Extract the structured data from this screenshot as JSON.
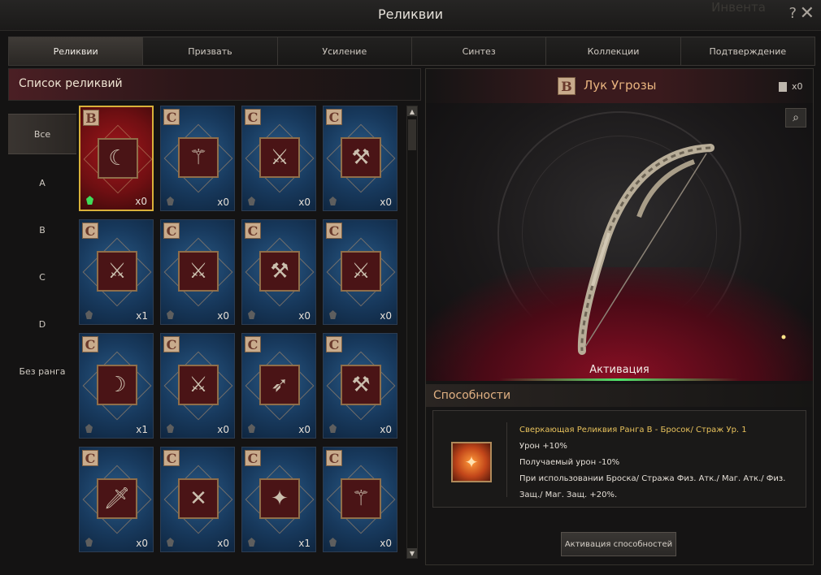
{
  "window": {
    "title": "Реликвии",
    "background_hint": "Инвента",
    "help_symbol": "?",
    "close_symbol": "✕"
  },
  "tabs": [
    {
      "label": "Реликвии",
      "active": true
    },
    {
      "label": "Призвать",
      "active": false
    },
    {
      "label": "Усиление",
      "active": false
    },
    {
      "label": "Синтез",
      "active": false
    },
    {
      "label": "Коллекции",
      "active": false
    },
    {
      "label": "Подтверждение",
      "active": false
    }
  ],
  "list": {
    "title": "Список реликвий",
    "filters": [
      {
        "label": "Все",
        "active": true
      },
      {
        "label": "A",
        "active": false
      },
      {
        "label": "B",
        "active": false
      },
      {
        "label": "C",
        "active": false
      },
      {
        "label": "D",
        "active": false
      },
      {
        "label": "Без ранга",
        "active": false
      }
    ],
    "cards": [
      {
        "rank": "B",
        "icon": "bow-icon",
        "glyph": "☾",
        "count": "x0",
        "gem": "on",
        "selected": true
      },
      {
        "rank": "C",
        "icon": "staff-icon",
        "glyph": "⚚",
        "count": "x0",
        "gem": "off"
      },
      {
        "rank": "C",
        "icon": "flame-sword-icon",
        "glyph": "⚔",
        "count": "x0",
        "gem": "off"
      },
      {
        "rank": "C",
        "icon": "mace-icon",
        "glyph": "⚒",
        "count": "x0",
        "gem": "off"
      },
      {
        "rank": "C",
        "icon": "crossed-swords-icon",
        "glyph": "⚔",
        "count": "x1",
        "gem": "off"
      },
      {
        "rank": "C",
        "icon": "crossed-swords-icon",
        "glyph": "⚔",
        "count": "x0",
        "gem": "off"
      },
      {
        "rank": "C",
        "icon": "hammer-icon",
        "glyph": "⚒",
        "count": "x0",
        "gem": "off"
      },
      {
        "rank": "C",
        "icon": "axe-icon",
        "glyph": "⚔",
        "count": "x0",
        "gem": "off"
      },
      {
        "rank": "C",
        "icon": "scythe-icon",
        "glyph": "☽",
        "count": "x1",
        "gem": "off"
      },
      {
        "rank": "C",
        "icon": "halberd-icon",
        "glyph": "⚔",
        "count": "x0",
        "gem": "off"
      },
      {
        "rank": "C",
        "icon": "crossbow-icon",
        "glyph": "➶",
        "count": "x0",
        "gem": "off"
      },
      {
        "rank": "C",
        "icon": "battle-axe-icon",
        "glyph": "⚒",
        "count": "x0",
        "gem": "off"
      },
      {
        "rank": "C",
        "icon": "dagger-icon",
        "glyph": "🗡",
        "count": "x0",
        "gem": "off"
      },
      {
        "rank": "C",
        "icon": "crossed-blades-icon",
        "glyph": "✕",
        "count": "x0",
        "gem": "off"
      },
      {
        "rank": "C",
        "icon": "spear-icon",
        "glyph": "✦",
        "count": "x1",
        "gem": "off"
      },
      {
        "rank": "C",
        "icon": "scepter-icon",
        "glyph": "⚚",
        "count": "x0",
        "gem": "off"
      }
    ]
  },
  "detail": {
    "rank": "B",
    "name": "Лук Угрозы",
    "owned_count": "x0",
    "activation_label": "Активация",
    "abilities_title": "Способности",
    "ability": {
      "name": "Сверкающая Реликвия Ранга B - Бросок/ Страж Ур. 1",
      "lines": [
        "Урон +10%",
        "Получаемый урон -10%",
        "При использовании Броска/ Стража Физ. Атк./ Маг. Атк./ Физ. Защ./ Маг. Защ. +20%."
      ]
    },
    "activate_button": "Активация способностей"
  },
  "colors": {
    "rank_b_card": "#a3161b",
    "rank_c_card": "#1f4a73",
    "selected_border": "#d9b13a",
    "accent_title": "#e9b47f",
    "ability_name": "#e8c25c",
    "gem_active": "#3fdc5a"
  }
}
